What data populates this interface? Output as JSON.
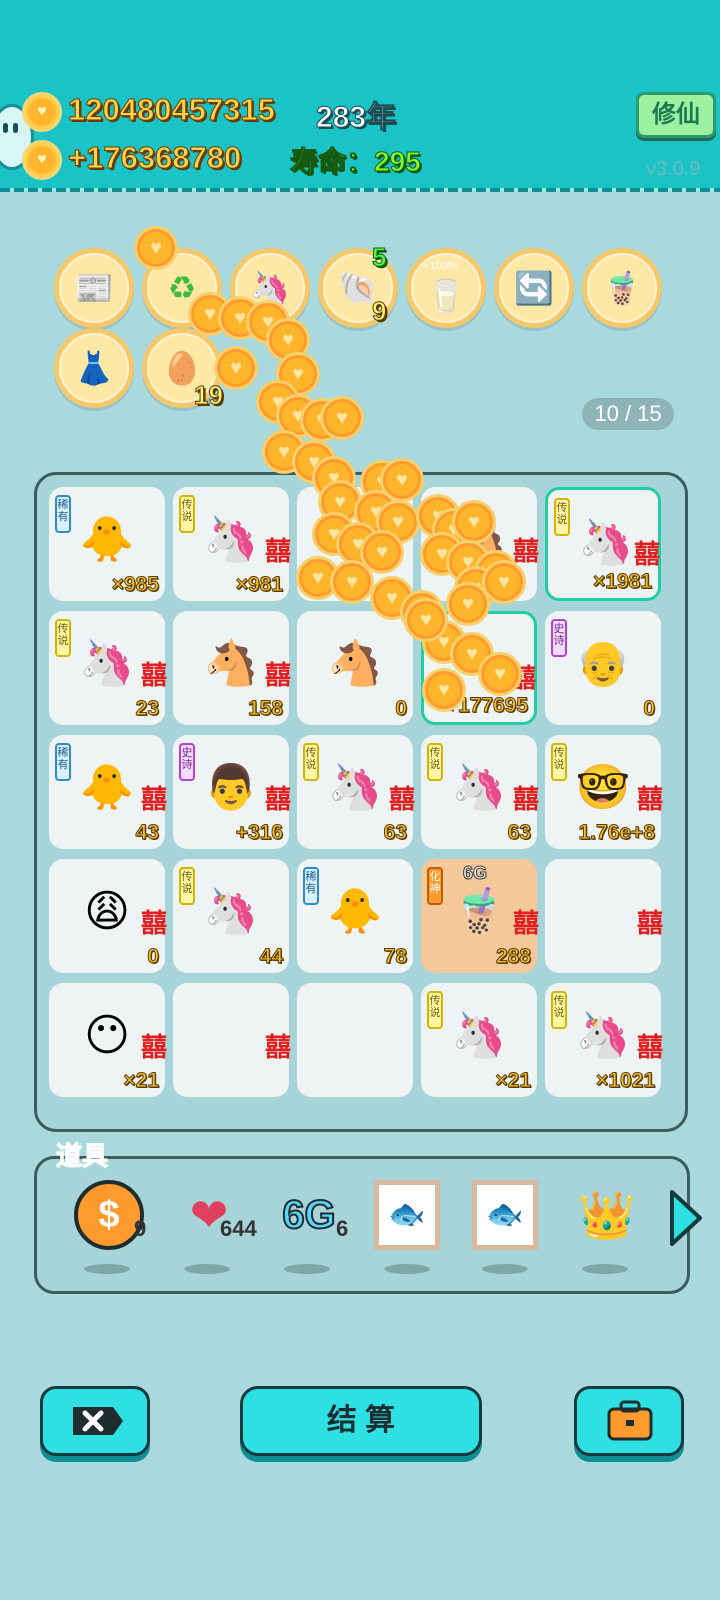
{
  "header": {
    "gold_total": "120480457315",
    "gold_rate": "+176368780",
    "year": "283年",
    "lifespan_label": "寿命：",
    "lifespan_value": "295",
    "mode_button": "修仙",
    "version": "v3.0.9"
  },
  "powerups": {
    "items": [
      {
        "name": "time-magazine",
        "icon": "📰"
      },
      {
        "name": "recycle",
        "icon": "♻"
      },
      {
        "name": "unicorn",
        "icon": "🦄"
      },
      {
        "name": "seashell",
        "icon": "🐚",
        "top_count": "5",
        "bottom_count": "9"
      },
      {
        "name": "boost-100",
        "icon": "🥛",
        "label": "+100%"
      },
      {
        "name": "refresh",
        "icon": "🔄"
      },
      {
        "name": "bubble-tea",
        "icon": "🧋"
      },
      {
        "name": "skirt",
        "icon": "👗"
      },
      {
        "name": "egg-tray",
        "icon": "🥚",
        "count": "19"
      }
    ],
    "progress": "10 / 15"
  },
  "board": {
    "cells": [
      {
        "tag": "稀有",
        "tag_type": "rare",
        "icon": "🐥",
        "count": "×985"
      },
      {
        "tag": "传说",
        "tag_type": "legend",
        "icon": "🦄",
        "xi": "囍",
        "count": "×981"
      },
      {
        "tag": "",
        "tag_type": "",
        "icon": "",
        "count": ""
      },
      {
        "tag": "",
        "tag_type": "",
        "icon": "🐴",
        "xi": "囍",
        "count": ""
      },
      {
        "tag": "传说",
        "tag_type": "legend",
        "icon": "🦄",
        "xi": "囍",
        "count": "×1981",
        "selected": true
      },
      {
        "tag": "传说",
        "tag_type": "legend",
        "icon": "🦄",
        "xi": "囍",
        "count": "23"
      },
      {
        "tag": "",
        "tag_type": "",
        "icon": "🐴",
        "xi": "囍",
        "count": "158"
      },
      {
        "tag": "",
        "tag_type": "",
        "icon": "🐴",
        "xi": "",
        "count": "0"
      },
      {
        "tag": "",
        "tag_type": "",
        "icon": "",
        "xi": "囍",
        "count": "+177695",
        "selected": true
      },
      {
        "tag": "史诗",
        "tag_type": "epic",
        "icon": "👴",
        "count": "0"
      },
      {
        "tag": "稀有",
        "tag_type": "rare",
        "icon": "🐥",
        "xi": "囍",
        "count": "43"
      },
      {
        "tag": "史诗",
        "tag_type": "epic",
        "icon": "👨",
        "xi": "囍",
        "count": "+316"
      },
      {
        "tag": "传说",
        "tag_type": "legend",
        "icon": "🦄",
        "xi": "囍",
        "count": "63"
      },
      {
        "tag": "传说",
        "tag_type": "legend",
        "icon": "🦄",
        "xi": "囍",
        "count": "63"
      },
      {
        "tag": "传说",
        "tag_type": "legend",
        "icon": "🤓",
        "xi": "囍",
        "count": "1.76e+8"
      },
      {
        "tag": "",
        "tag_type": "",
        "icon": "😩",
        "xi": "囍",
        "count": "0"
      },
      {
        "tag": "传说",
        "tag_type": "legend",
        "icon": "🦄",
        "count": "44"
      },
      {
        "tag": "稀有",
        "tag_type": "rare",
        "icon": "🐥",
        "count": "78"
      },
      {
        "tag": "化神",
        "tag_type": "god",
        "icon": "🧋",
        "xi": "囍",
        "count": "288",
        "gold": true,
        "label": "6G"
      },
      {
        "tag": "",
        "tag_type": "",
        "icon": "",
        "xi": "囍",
        "count": ""
      },
      {
        "tag": "",
        "tag_type": "",
        "icon": "😶",
        "xi": "囍",
        "count": "×21"
      },
      {
        "tag": "",
        "tag_type": "",
        "icon": "",
        "xi": "囍",
        "count": ""
      },
      {
        "tag": "",
        "tag_type": "",
        "icon": "",
        "count": ""
      },
      {
        "tag": "传说",
        "tag_type": "legend",
        "icon": "🦄",
        "count": "×21"
      },
      {
        "tag": "传说",
        "tag_type": "legend",
        "icon": "🦄",
        "xi": "囍",
        "count": "×1021"
      }
    ]
  },
  "tools": {
    "title": "道具",
    "items": [
      {
        "name": "dollar-coin",
        "icon": "💲",
        "count": "9"
      },
      {
        "name": "liver",
        "icon": "🫀",
        "count": "644"
      },
      {
        "name": "6g",
        "icon": "6G",
        "count": "6"
      },
      {
        "name": "fish-frame-1",
        "icon": "🐟",
        "count": ""
      },
      {
        "name": "fish-frame-2",
        "icon": "🐟",
        "count": ""
      },
      {
        "name": "crown",
        "icon": "👑",
        "count": ""
      }
    ]
  },
  "bottom": {
    "settle_label": "结 算"
  },
  "colors": {
    "topbar": "#19c3c6",
    "background": "#a9d8dd",
    "gold": "#ffd34a",
    "lifespan": "#7cff2a",
    "button": "#2fe0e2"
  }
}
